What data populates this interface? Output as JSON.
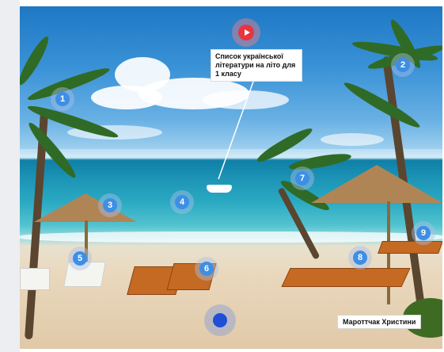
{
  "scene": {
    "callout_text": "Список української літератури на літо для 1 класу",
    "author_label": "Мароттчак Христини"
  },
  "hotspots": [
    {
      "number": "1"
    },
    {
      "number": "2"
    },
    {
      "number": "3"
    },
    {
      "number": "4"
    },
    {
      "number": "5"
    },
    {
      "number": "6"
    },
    {
      "number": "7"
    },
    {
      "number": "8"
    },
    {
      "number": "9"
    }
  ],
  "icons": {
    "play": "play-icon",
    "record": "record-icon"
  },
  "colors": {
    "hotspot": "#3d8fe6",
    "play": "#e8343f",
    "record": "#1f4fd6"
  }
}
